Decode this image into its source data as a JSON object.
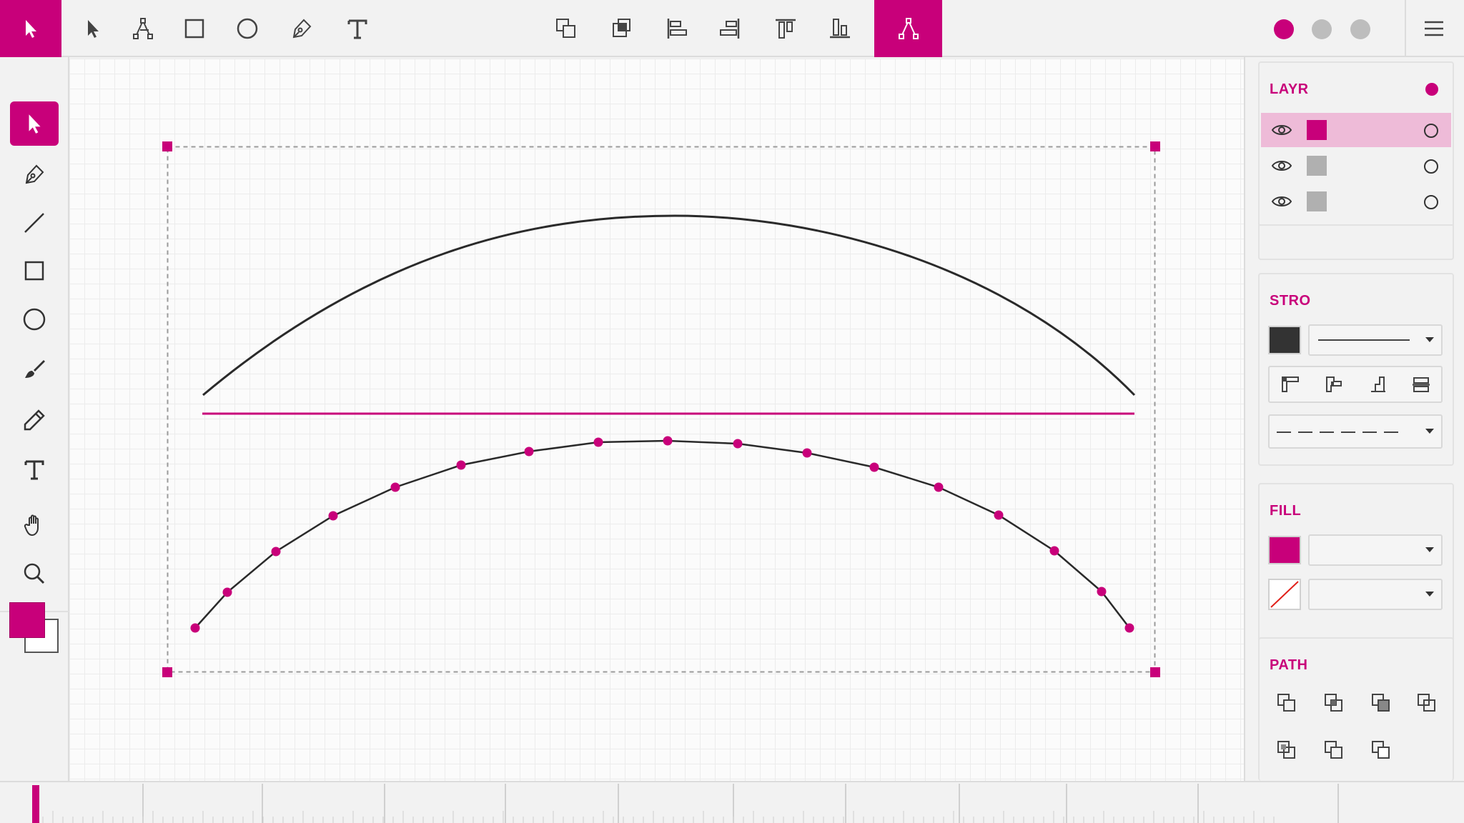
{
  "app": {
    "accent_color": "#c8007a",
    "stroke_color": "#2a2a2a",
    "top_toolbar": {
      "tools": [
        "select-arrow",
        "direct-select",
        "rectangle",
        "ellipse",
        "pen",
        "text"
      ],
      "arrange": [
        "bring-forward",
        "send-backward",
        "align-left",
        "align-right",
        "align-top",
        "align-bottom"
      ],
      "active_tool": "path-edit",
      "status_dots": [
        "#c8007a",
        "#bdbdbd",
        "#bdbdbd"
      ]
    },
    "left_toolbar": {
      "tools": [
        "select",
        "pen",
        "line",
        "rectangle",
        "ellipse",
        "brush",
        "pencil",
        "text",
        "hand",
        "zoom"
      ],
      "active_index": 0,
      "fill_swatch": "#c8007a",
      "stroke_swatch": "#ffffff"
    },
    "panels": {
      "layers": {
        "title": "LAYR",
        "rows": [
          {
            "color": "#c8007a",
            "selected": true
          },
          {
            "color": "#b0b0b0",
            "selected": false
          },
          {
            "color": "#b0b0b0",
            "selected": false
          }
        ]
      },
      "stroke": {
        "title": "STRO",
        "color": "#333333"
      },
      "fill": {
        "title": "FILL",
        "color": "#c8007a",
        "none_swatch": "none"
      },
      "path": {
        "title": "PATH"
      }
    }
  }
}
